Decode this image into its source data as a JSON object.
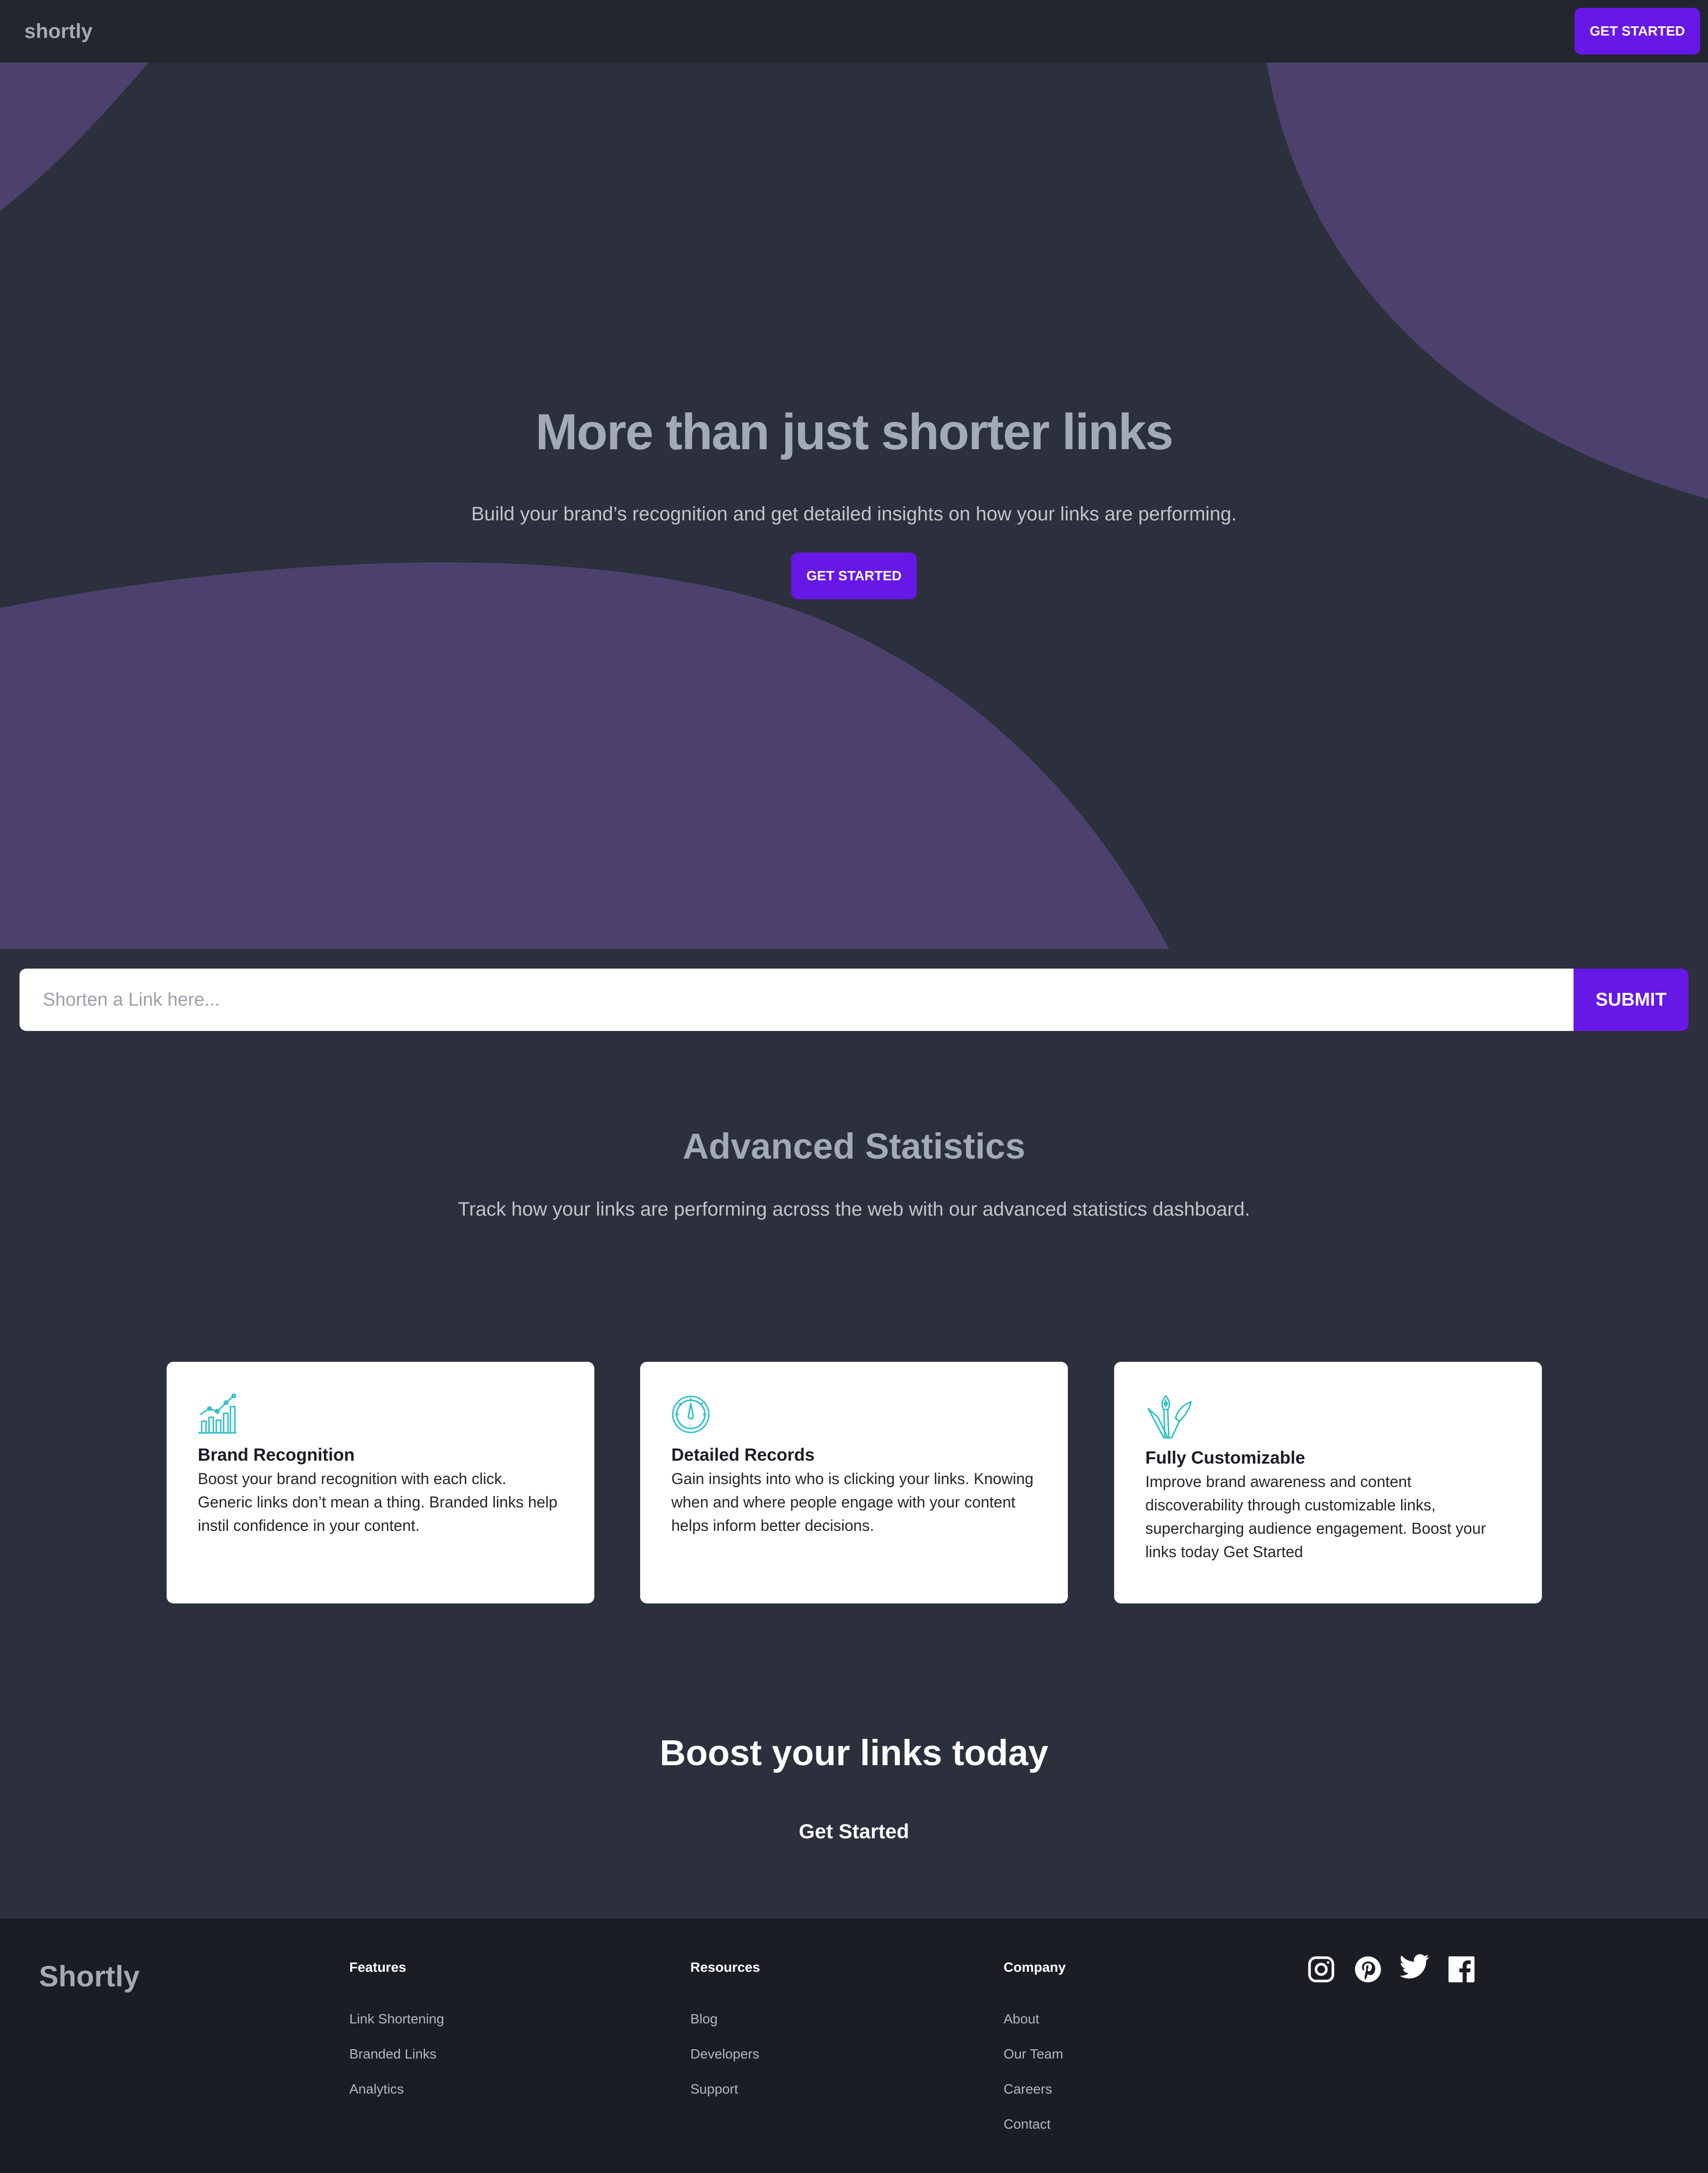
{
  "brand": {
    "nav_logo": "shortly",
    "footer_logo": "Shortly"
  },
  "colors": {
    "accent": "#6718e6",
    "icon_teal": "#2bc0c6",
    "blob": "#4b416c",
    "background": "#2c303c",
    "footer": "#1a1d24"
  },
  "nav": {
    "cta_label": "GET STARTED"
  },
  "hero": {
    "title": "More than just shorter links",
    "subtitle": "Build your brand’s recognition and get detailed insights on how your links are performing.",
    "cta_label": "GET STARTED"
  },
  "shorten": {
    "placeholder": "Shorten a Link here...",
    "submit_label": "SUBMIT"
  },
  "stats": {
    "title": "Advanced Statistics",
    "subtitle": "Track how your links are performing across the web with our advanced statistics dashboard.",
    "cards": [
      {
        "icon": "bar-chart-icon",
        "title": "Brand Recognition",
        "text": "Boost your brand recognition with each click. Generic links don’t mean a thing. Branded links help instil confidence in your content."
      },
      {
        "icon": "gauge-icon",
        "title": "Detailed Records",
        "text": "Gain insights into who is clicking your links. Knowing when and where people engage with your content helps inform better decisions."
      },
      {
        "icon": "pen-tools-icon",
        "title": "Fully Customizable",
        "text": "Improve brand awareness and content discoverability through customizable links, supercharging audience engagement. Boost your links today Get Started"
      }
    ]
  },
  "boost": {
    "title": "Boost your links today",
    "link_label": "Get Started"
  },
  "footer": {
    "columns": [
      {
        "heading": "Features",
        "links": [
          "Link Shortening",
          "Branded Links",
          "Analytics"
        ]
      },
      {
        "heading": "Resources",
        "links": [
          "Blog",
          "Developers",
          "Support"
        ]
      },
      {
        "heading": "Company",
        "links": [
          "About",
          "Our Team",
          "Careers",
          "Contact"
        ]
      }
    ],
    "social": [
      "instagram-icon",
      "pinterest-icon",
      "twitter-icon",
      "facebook-icon"
    ]
  }
}
